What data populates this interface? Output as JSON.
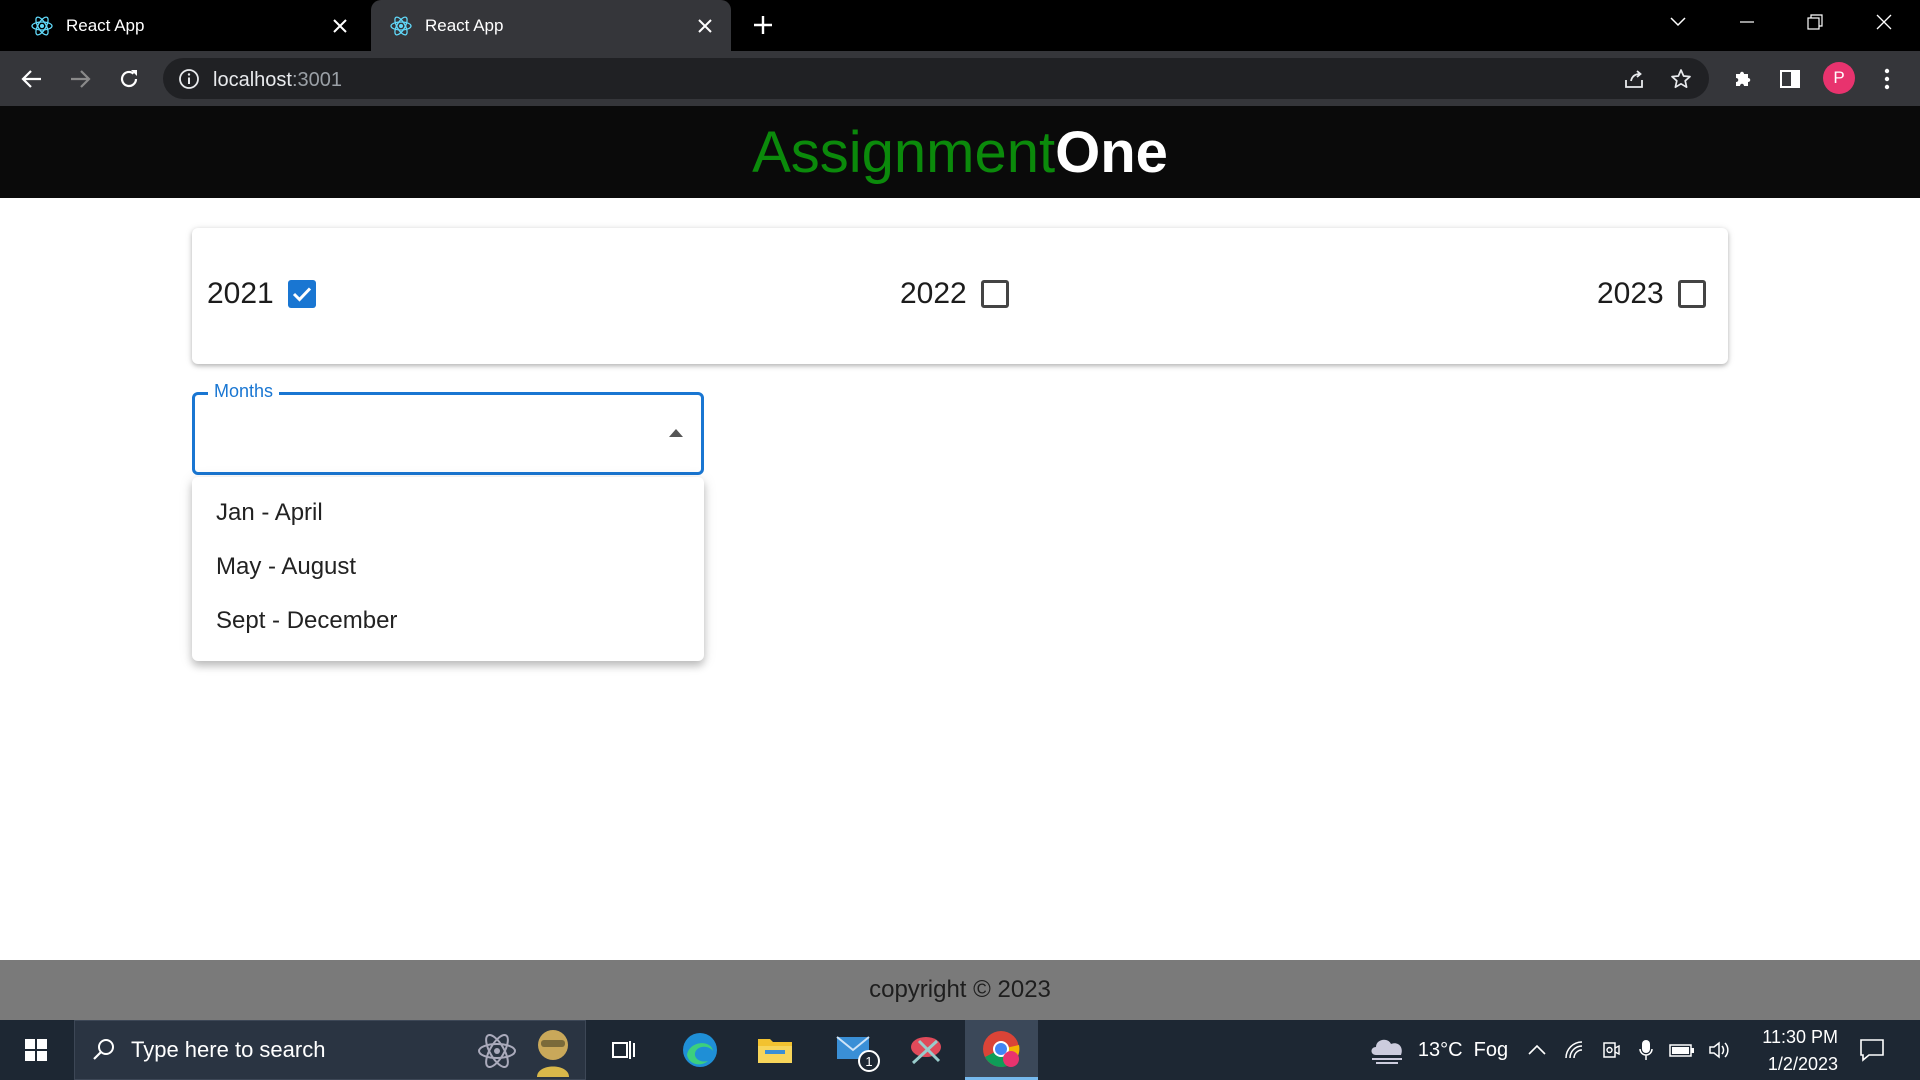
{
  "browser": {
    "tabs": [
      {
        "title": "React App",
        "active": false
      },
      {
        "title": "React App",
        "active": true
      }
    ],
    "url_host": "localhost",
    "url_port": ":3001",
    "profile_initial": "P"
  },
  "app": {
    "title_part1": "Assignment",
    "title_part2": "One",
    "title_color1": "#0b8a0b",
    "title_color2": "#ffffff"
  },
  "years": [
    {
      "label": "2021",
      "checked": true
    },
    {
      "label": "2022",
      "checked": false
    },
    {
      "label": "2023",
      "checked": false
    }
  ],
  "months_select": {
    "label": "Months",
    "value": "",
    "open": true,
    "options": [
      "Jan - April",
      "May - August",
      "Sept - December"
    ]
  },
  "footer": {
    "text": "copyright © 2023"
  },
  "taskbar": {
    "search_placeholder": "Type here to search",
    "weather": "13°C  Fog",
    "time": "11:30 PM",
    "date": "1/2/2023",
    "mail_badge": "1"
  },
  "colors": {
    "accent": "#1976d2",
    "header_bg": "#0a0a0a",
    "footer_bg": "#7a7a7a"
  }
}
